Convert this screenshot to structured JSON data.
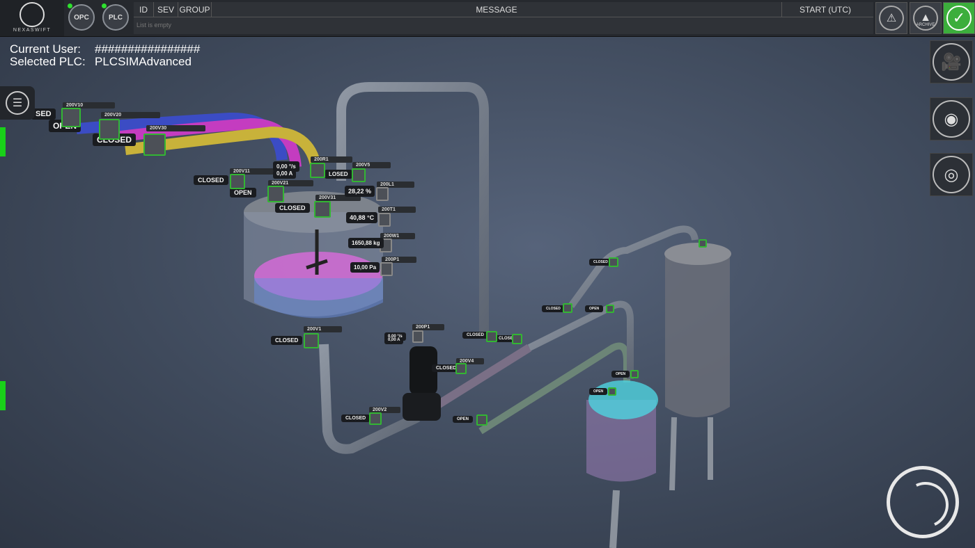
{
  "app": {
    "brand": "NEXASWIFT"
  },
  "connections": [
    {
      "label": "OPC",
      "status_color": "#2ee02e"
    },
    {
      "label": "PLC",
      "status_color": "#2ee02e"
    }
  ],
  "alarm_table": {
    "columns": [
      "ID",
      "SEV",
      "GROUP",
      "MESSAGE",
      "START (UTC)"
    ],
    "empty_text": "List is empty"
  },
  "toolbar": {
    "alarm_icon": "alarm-list-icon",
    "archive_label": "ARCHIVE",
    "ack_icon": "checkmark-icon",
    "ack_color": "#3cae3c"
  },
  "info": {
    "current_user_label": "Current User:",
    "current_user_value": "################",
    "selected_plc_label": "Selected PLC:",
    "selected_plc_value": "PLCSIMAdvanced"
  },
  "side_buttons": [
    "camera-icon",
    "eye-icon",
    "eye-toggle-icon"
  ],
  "scene": {
    "valve_labels": [
      {
        "text": "SED"
      },
      {
        "text": "OPEN"
      },
      {
        "text": "CLOSED"
      },
      {
        "text": "CLOSED"
      },
      {
        "text": "OPEN"
      },
      {
        "text": "CLOSED"
      },
      {
        "text": "LOSED"
      },
      {
        "text": "CLOSED"
      },
      {
        "text": "CLOSED"
      },
      {
        "text": "CLOSED"
      },
      {
        "text": "CLOSED"
      },
      {
        "text": "OPEN"
      },
      {
        "text": "CLOSED"
      },
      {
        "text": "CLOSED"
      },
      {
        "text": "OPEN"
      },
      {
        "text": "CLOSED"
      },
      {
        "text": "OPEN"
      },
      {
        "text": "OPEN"
      }
    ],
    "tags": [
      "200V10",
      "200V20",
      "200V30",
      "200V11",
      "200V21",
      "200V31",
      "200R1",
      "200V5",
      "200L1",
      "200T1",
      "200W1",
      "200P1",
      "200V1",
      "200P1",
      "200V2",
      "200V4"
    ],
    "measurements": [
      {
        "value": "0,00",
        "unit": "°/s"
      },
      {
        "value": "0,00",
        "unit": "A"
      },
      {
        "value": "28,22",
        "unit": "%"
      },
      {
        "value": "40,88",
        "unit": "°C"
      },
      {
        "value": "1650,88",
        "unit": "kg"
      },
      {
        "value": "10,00",
        "unit": "Pa"
      },
      {
        "value": "0,00",
        "unit": "°/s"
      },
      {
        "value": "0,00",
        "unit": "A"
      }
    ],
    "fluid_colors": {
      "reactor": "#d36bd6",
      "tank_small": "#4fd3e0",
      "pipe_blue": "#3b4cc4",
      "pipe_magenta": "#c43cc0",
      "pipe_yellow": "#c8b23a"
    }
  }
}
